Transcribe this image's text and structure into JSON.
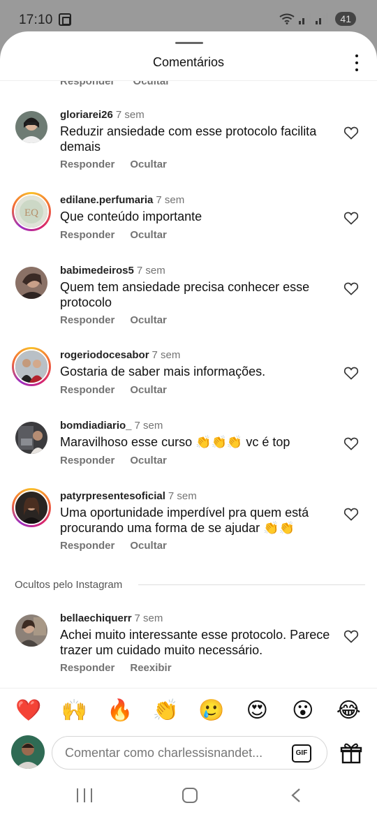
{
  "status_bar": {
    "time": "17:10",
    "battery": "41"
  },
  "header": {
    "title": "Comentários"
  },
  "partial_actions": {
    "reply": "Responder",
    "hide": "Ocultar"
  },
  "comments": [
    {
      "user": "gloriarei26",
      "time": "7 sem",
      "text": "Reduzir ansiedade com esse protocolo facilita demais",
      "reply": "Responder",
      "hide": "Ocultar"
    },
    {
      "user": "edilane.perfumaria",
      "time": "7 sem",
      "text": "Que conteúdo importante",
      "reply": "Responder",
      "hide": "Ocultar",
      "avatar_text": "EQ"
    },
    {
      "user": "babimedeiros5",
      "time": "7 sem",
      "text": "Quem tem ansiedade precisa conhecer esse protocolo",
      "reply": "Responder",
      "hide": "Ocultar"
    },
    {
      "user": "rogeriodocesabor",
      "time": "7 sem",
      "text": "Gostaria de saber mais informações.",
      "reply": "Responder",
      "hide": "Ocultar"
    },
    {
      "user": "bomdiadiario_",
      "time": "7 sem",
      "text": "Maravilhoso esse curso 👏👏👏 vc é top",
      "reply": "Responder",
      "hide": "Ocultar"
    },
    {
      "user": "patyrpresentesoficial",
      "time": "7 sem",
      "text": "Uma oportunidade imperdível pra quem está procurando uma forma de se ajudar 👏👏",
      "reply": "Responder",
      "hide": "Ocultar"
    }
  ],
  "hidden_section": {
    "label": "Ocultos pelo Instagram",
    "comment": {
      "user": "bellaechiquerr",
      "time": "7 sem",
      "text": "Achei muito interessante esse protocolo. Parece trazer um cuidado muito necessário.",
      "reply": "Responder",
      "show": "Reexibir"
    }
  },
  "emoji_bar": [
    "❤️",
    "🙌",
    "🔥",
    "👏",
    "🥲",
    "😍",
    "😮",
    "😂"
  ],
  "composer": {
    "placeholder": "Comentar como charlessisnandet...",
    "gif_label": "GIF"
  },
  "colors": {
    "secondary_text": "#737373",
    "story_ring": "#d6246e"
  }
}
